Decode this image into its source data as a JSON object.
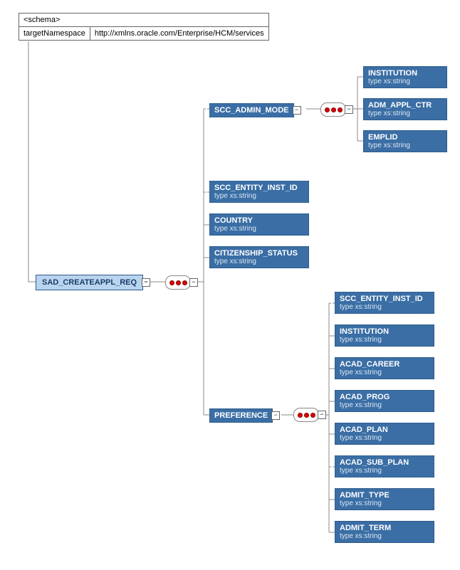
{
  "schema": {
    "header": "<schema>",
    "ns_label": "targetNamespace",
    "ns_value": "http://xmlns.oracle.com/Enterprise/HCM/services"
  },
  "root": {
    "name": "SAD_CREATEAPPL_REQ"
  },
  "type_label": "type xs:string",
  "admin_mode": {
    "name": "SCC_ADMIN_MODE",
    "children": [
      {
        "name": "INSTITUTION"
      },
      {
        "name": "ADM_APPL_CTR"
      },
      {
        "name": "EMPLID"
      }
    ]
  },
  "level2": [
    {
      "name": "SCC_ENTITY_INST_ID",
      "optional": true
    },
    {
      "name": "COUNTRY",
      "optional": false
    },
    {
      "name": "CITIZENSHIP_STATUS",
      "optional": false
    }
  ],
  "preference": {
    "name": "PREFERENCE",
    "children": [
      {
        "name": "SCC_ENTITY_INST_ID",
        "optional": true
      },
      {
        "name": "INSTITUTION",
        "optional": false
      },
      {
        "name": "ACAD_CAREER",
        "optional": false
      },
      {
        "name": "ACAD_PROG",
        "optional": false
      },
      {
        "name": "ACAD_PLAN",
        "optional": false
      },
      {
        "name": "ACAD_SUB_PLAN",
        "optional": true
      },
      {
        "name": "ADMIT_TYPE",
        "optional": false
      },
      {
        "name": "ADMIT_TERM",
        "optional": false
      }
    ]
  }
}
